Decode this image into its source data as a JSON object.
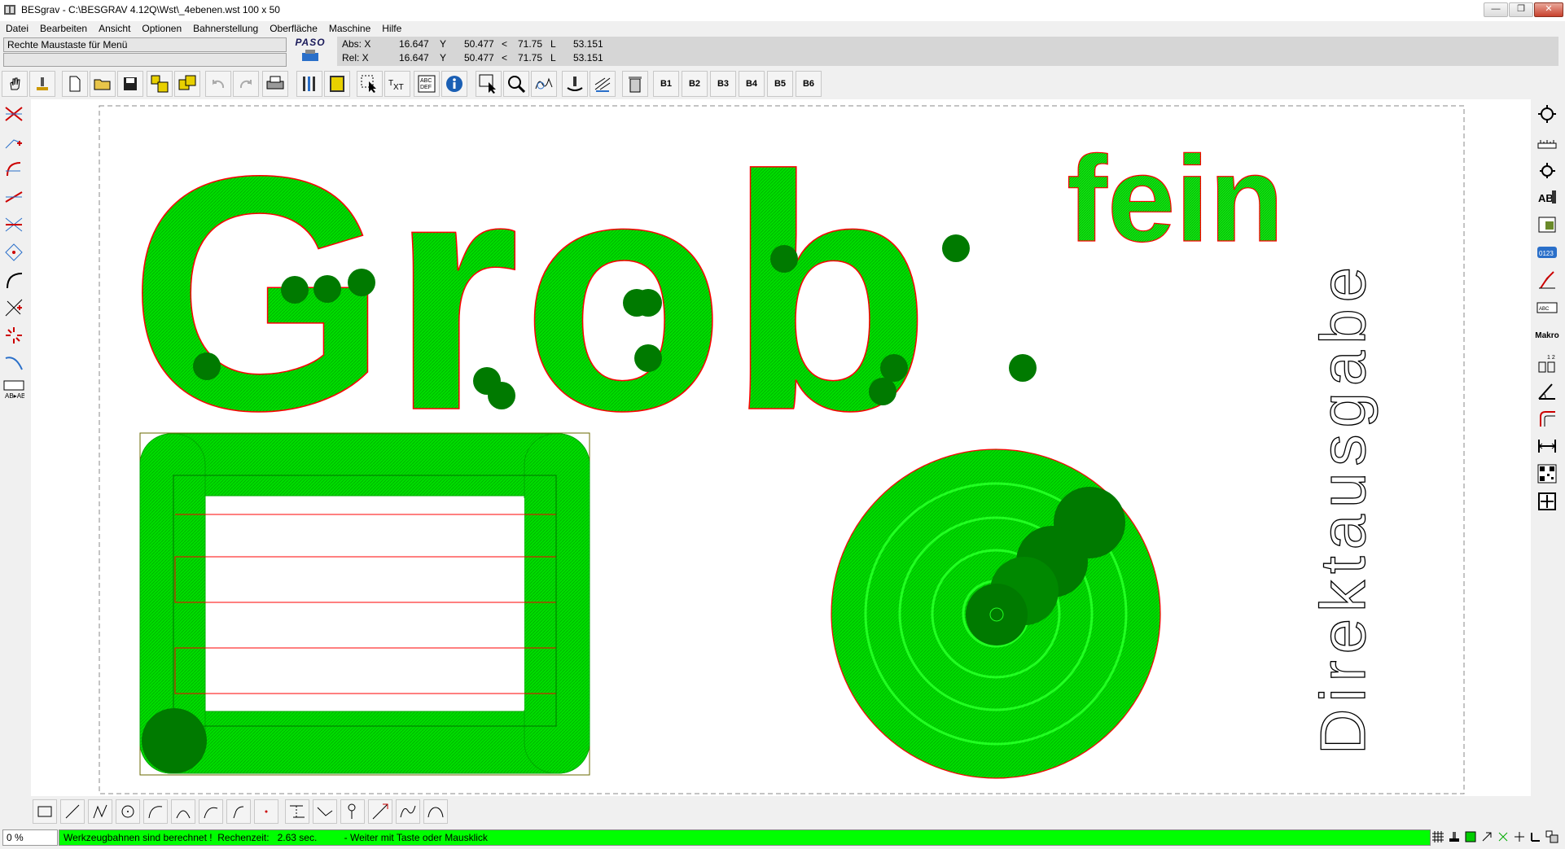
{
  "window": {
    "title": "BESgrav - C:\\BESGRAV 4.12Q\\Wst\\_4ebenen.wst   100 x 50",
    "buttons": {
      "minimize": "—",
      "restore": "❐",
      "close": "✕"
    }
  },
  "menu": [
    "Datei",
    "Bearbeiten",
    "Ansicht",
    "Optionen",
    "Bahnerstellung",
    "Oberfläche",
    "Maschine",
    "Hilfe"
  ],
  "info": {
    "hint": "Rechte Maustaste für Menü",
    "logo": "PASO",
    "abs": {
      "label": "Abs: X",
      "x": "16.647",
      "ylabel": "Y",
      "y": "50.477",
      "lt": "<",
      "a": "71.75",
      "llabel": "L",
      "l": "53.151"
    },
    "rel": {
      "label": "Rel: X",
      "x": "16.647",
      "ylabel": "Y",
      "y": "50.477",
      "lt": "<",
      "a": "71.75",
      "llabel": "L",
      "l": "53.151"
    }
  },
  "toolbar": {
    "icons": [
      "hand-icon",
      "machine-icon",
      "new-file-icon",
      "open-folder-icon",
      "save-icon",
      "layers-icon",
      "layers-copy-icon",
      "undo-icon",
      "redo-icon",
      "print-icon",
      "tools-icon",
      "calculator-icon",
      "select-icon",
      "text-icon",
      "font-icon",
      "info-icon",
      "zoom-select-icon",
      "zoom-icon",
      "path-icon",
      "engrave-icon",
      "hatch-icon",
      "trash-icon"
    ],
    "layer_buttons": [
      "B1",
      "B2",
      "B3",
      "B4",
      "B5",
      "B6"
    ]
  },
  "canvas": {
    "big_text": "Grob",
    "small_text": "fein",
    "vertical_text": "Direktausgabe",
    "colors": {
      "fill": "#00dd00",
      "fill_light": "#22ee22",
      "stroke": "#007700",
      "outline": "#ff0000",
      "center": "#00cccc",
      "dark": "#007a00"
    }
  },
  "right_tools": {
    "makro_label": "Makro"
  },
  "status": {
    "percent": "0 %",
    "message": "Werkzeugbahnen sind berechnet !  Rechenzeit:   2.63 sec.          - Weiter mit Taste oder Mausklick"
  }
}
